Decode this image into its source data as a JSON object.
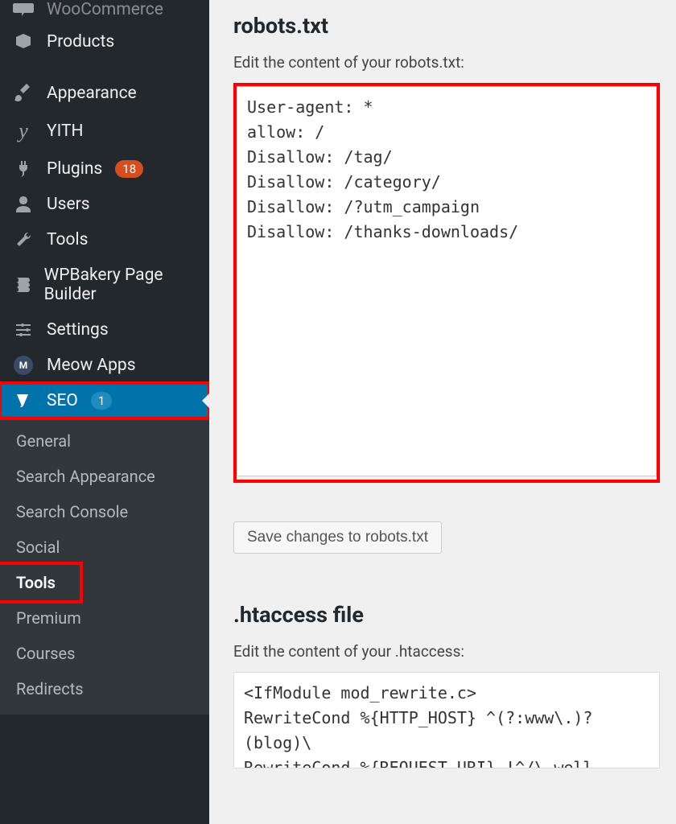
{
  "sidebar": {
    "items": [
      {
        "label": "WooCommerce",
        "icon": "woocommerce"
      },
      {
        "label": "Products",
        "icon": "box"
      },
      {
        "label": "Appearance",
        "icon": "brush"
      },
      {
        "label": "YITH",
        "icon": "yith"
      },
      {
        "label": "Plugins",
        "icon": "plug",
        "badge": "18"
      },
      {
        "label": "Users",
        "icon": "user"
      },
      {
        "label": "Tools",
        "icon": "wrench"
      },
      {
        "label": "WPBakery Page Builder",
        "icon": "wpbakery"
      },
      {
        "label": "Settings",
        "icon": "sliders"
      },
      {
        "label": "Meow Apps",
        "icon": "meow"
      },
      {
        "label": "SEO",
        "icon": "yoast",
        "badge": "1",
        "current": true
      }
    ],
    "submenu": [
      {
        "label": "General"
      },
      {
        "label": "Search Appearance"
      },
      {
        "label": "Search Console"
      },
      {
        "label": "Social"
      },
      {
        "label": "Tools",
        "current": true
      },
      {
        "label": "Premium"
      },
      {
        "label": "Courses"
      },
      {
        "label": "Redirects"
      }
    ]
  },
  "main": {
    "robots": {
      "heading": "robots.txt",
      "description": "Edit the content of your robots.txt:",
      "value": "User-agent: *\nallow: /\nDisallow: /tag/\nDisallow: /category/\nDisallow: /?utm_campaign\nDisallow: /thanks-downloads/",
      "save_label": "Save changes to robots.txt"
    },
    "htaccess": {
      "heading": ".htaccess file",
      "description": "Edit the content of your .htaccess:",
      "value": "<IfModule mod_rewrite.c>\nRewriteCond %{HTTP_HOST} ^(?:www\\.)?(blog)\\\nRewriteCond %{REQUEST_URI} !^/\\.well-known/\nRewriteCond %{REQUEST_URI} !^/\\.well-known/"
    }
  }
}
